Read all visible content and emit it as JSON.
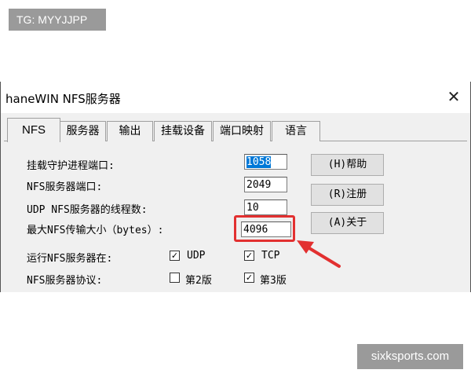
{
  "watermarks": {
    "top_left": "TG: MYYJJPP",
    "bottom_right": "sixksports.com"
  },
  "window": {
    "title": "haneWIN NFS服务器",
    "close_glyph": "✕"
  },
  "tabs": [
    {
      "label": "NFS",
      "active": true
    },
    {
      "label": "服务器",
      "active": false
    },
    {
      "label": "输出",
      "active": false
    },
    {
      "label": "挂载设备",
      "active": false
    },
    {
      "label": "端口映射",
      "active": false
    },
    {
      "label": "语言",
      "active": false
    }
  ],
  "form": {
    "mount_daemon_port": {
      "label": "挂载守护进程端口:",
      "value": "1058",
      "selected": true
    },
    "nfs_server_port": {
      "label": "NFS服务器端口:",
      "value": "2049"
    },
    "udp_threads": {
      "label": "UDP NFS服务器的线程数:",
      "value": "10"
    },
    "max_nfs_transfer": {
      "label": "最大NFS传输大小（bytes）:",
      "value": "4096"
    },
    "run_nfs_on": {
      "label": "运行NFS服务器在:",
      "udp": {
        "label": "UDP",
        "checked": true
      },
      "tcp": {
        "label": "TCP",
        "checked": true
      }
    },
    "nfs_protocol": {
      "label": "NFS服务器协议:",
      "v2": {
        "label": "第2版",
        "checked": false
      },
      "v3": {
        "label": "第3版",
        "checked": true
      }
    }
  },
  "buttons": {
    "help": "(H)帮助",
    "register": "(R)注册",
    "about": "(A)关于"
  },
  "check_glyph": "✓",
  "colors": {
    "annotation": "#e23030",
    "selection": "#0078d7"
  }
}
